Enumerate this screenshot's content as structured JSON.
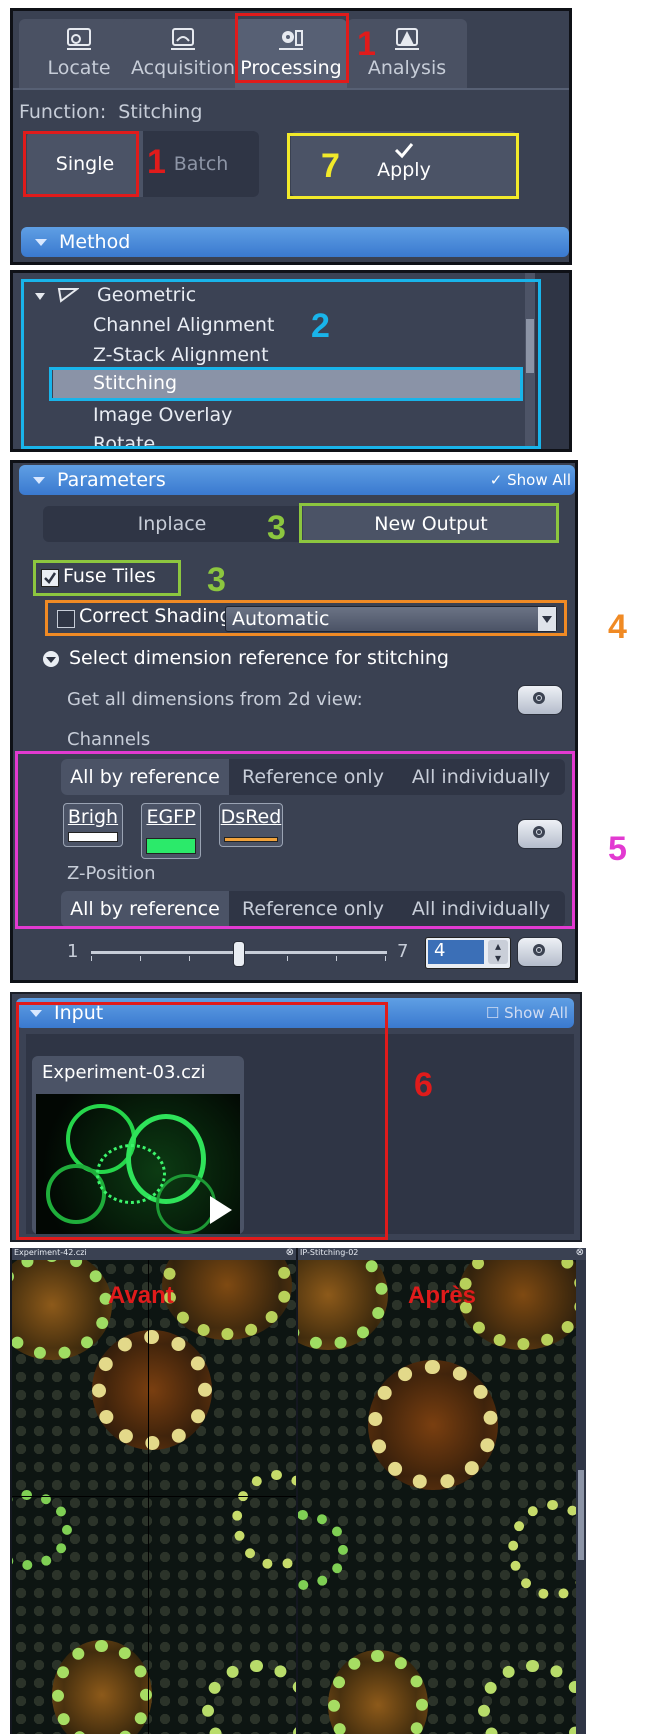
{
  "tabs": [
    {
      "label": "Locate",
      "icon": "locate-icon"
    },
    {
      "label": "Acquisition",
      "icon": "acquisition-icon"
    },
    {
      "label": "Processing",
      "icon": "processing-icon",
      "active": true
    },
    {
      "label": "Analysis",
      "icon": "analysis-icon"
    }
  ],
  "function": {
    "label": "Function:",
    "value": "Stitching"
  },
  "mode": {
    "single": "Single",
    "batch": "Batch",
    "selected": "Single"
  },
  "apply_label": "Apply",
  "method_header": "Method",
  "method_tree": {
    "group": "Geometric",
    "items": [
      "Channel Alignment",
      "Z-Stack Alignment",
      "Stitching",
      "Image Overlay",
      "Rotate"
    ],
    "selected": "Stitching"
  },
  "parameters": {
    "header": "Parameters",
    "show_all": "Show All",
    "output_options": [
      "Inplace",
      "New Output"
    ],
    "output_selected": "New Output",
    "fuse_tiles": {
      "label": "Fuse Tiles",
      "checked": true
    },
    "correct_shading": {
      "label": "Correct Shading",
      "checked": false,
      "mode": "Automatic"
    },
    "dimension_section": "Select dimension reference for stitching",
    "get_all_dims": "Get all dimensions from 2d view:",
    "channels_label": "Channels",
    "channel_modes": [
      "All by reference",
      "Reference only",
      "All individually"
    ],
    "channels": [
      {
        "name": "Brigh",
        "color": "#ffffff"
      },
      {
        "name": "EGFP",
        "color": "#2bea6a"
      },
      {
        "name": "DsRed",
        "color": "#f1a23b"
      }
    ],
    "zposition_label": "Z-Position",
    "z_modes": [
      "All by reference",
      "Reference only",
      "All individually"
    ],
    "slider": {
      "min": "1",
      "max": "7",
      "value": "4",
      "fraction": 0.5
    }
  },
  "input": {
    "header": "Input",
    "show_all": "Show All",
    "filename": "Experiment-03.czi"
  },
  "viewers": {
    "left": {
      "title": "Experiment-42.czi",
      "label": "Avant"
    },
    "right": {
      "title": "IP-Stitching-02",
      "label": "Après"
    }
  },
  "annotations": [
    "1",
    "1",
    "7",
    "2",
    "3",
    "3",
    "4",
    "5",
    "6"
  ],
  "colors": {
    "panel_bg": "#3a4152",
    "highlight_blue_bar": "#4a8ee0",
    "anno_red": "#e01b1b",
    "anno_yellow": "#f2ea2a",
    "anno_cyan": "#19b4ea",
    "anno_green": "#8cc63f",
    "anno_orange": "#f08a24",
    "anno_magenta": "#e23ad1"
  }
}
